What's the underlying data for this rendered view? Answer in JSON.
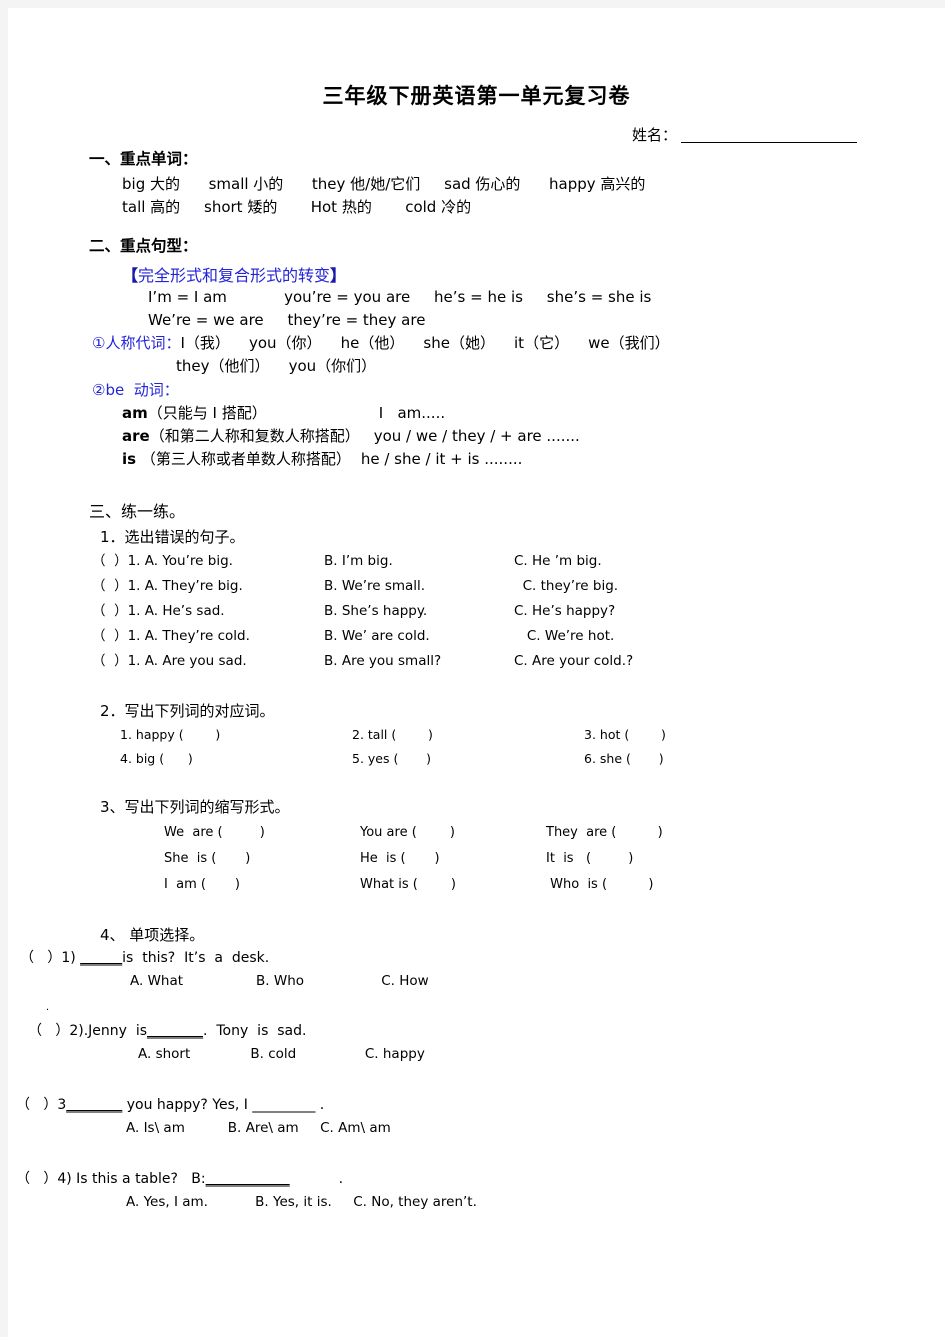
{
  "document": {
    "title": "三年级下册英语第一单元复习卷",
    "name_label": "姓名：",
    "name_blank": ""
  },
  "section_one": {
    "heading": "一、重点单词：",
    "rows": [
      "big 大的      small 小的      they 他/她/它们     sad 伤心的      happy 高兴的",
      "tall 高的     short 矮的       Hot 热的       cold 冷的"
    ]
  },
  "section_two": {
    "heading": "二、重点句型：",
    "bracket_open": "【",
    "bracket_title": "完全形式和复合形式的转变",
    "bracket_close": "】",
    "contraction_lines": [
      "I’m = I am            you’re = you are     he’s = he is     she’s = she is",
      "We’re = we are     they’re = they are"
    ],
    "pronoun_label": "①人称代词：",
    "pronoun_line1": "I（我）    you（你）    he（他）    she（她）    it（它）    we（我们）",
    "pronoun_line2": "they（他们）    you（你们）",
    "be_label": "②be  动词：",
    "be_rows": [
      {
        "verb": "am",
        "rule": "（只能与 I 搭配）",
        "example": "I   am....."
      },
      {
        "verb": "are",
        "rule": "（和第二人称和复数人称搭配）",
        "example": "you / we / they / + are ......."
      },
      {
        "verb": "is",
        "rule": " （第三人称或者单数人称搭配）",
        "example": "he / she / it + is ........"
      }
    ]
  },
  "section_three": {
    "heading": "三、练一练。",
    "ex1": {
      "heading": "1．选出错误的句子。",
      "rows": [
        {
          "stem": "（  ）1. A. You’re big.",
          "b": "B. I’m big.",
          "c": "C. He ’m big."
        },
        {
          "stem": "（  ）1. A. They’re big.",
          "b": "B. We’re small.",
          "c": "  C. they’re big."
        },
        {
          "stem": "（  ）1. A. He’s sad.",
          "b": "B. She’s happy.",
          "c": "C. He’s happy?"
        },
        {
          "stem": "（  ）1. A. They’re cold.",
          "b": "B. We’ are cold.",
          "c": "   C. We’re hot."
        },
        {
          "stem": "（  ）1. A. Are you sad.",
          "b": "B. Are you small?",
          "c": "C. Are your cold.?"
        }
      ]
    },
    "ex2": {
      "heading": "2．写出下列词的对应词。",
      "rows": [
        [
          "1. happy (        )",
          "2. tall (        )",
          "3. hot (        )"
        ],
        [
          "4. big (      )",
          "5. yes (       )",
          "6. she (       )"
        ]
      ]
    },
    "ex3": {
      "heading": "3、写出下列词的缩写形式。",
      "rows": [
        [
          "We  are (         )",
          "You are (        )",
          "They  are (          )"
        ],
        [
          "She  is (       )",
          "He  is (       )",
          "It  is   (         )"
        ],
        [
          "I  am (       )",
          "What is (        )",
          " Who  is (          )"
        ]
      ]
    },
    "ex4": {
      "heading": "4、 单项选择。",
      "stray_mark": ".",
      "questions": [
        {
          "stem_pre": "（   ）1) ",
          "stem_blank": "______",
          "stem_post": "is  this?  It’s  a  desk.",
          "options": "A. What                 B. Who                  C. How"
        },
        {
          "stem_pre": "（   ）2).Jenny  is",
          "stem_blank": "________",
          "stem_post": ".  Tony  is  sad.",
          "options": "A. short              B. cold                C. happy"
        },
        {
          "stem_pre": "（   ）3",
          "stem_blank": "________",
          "stem_post": " you happy? Yes, I _________ .",
          "options": "A. Is\\ am          B. Are\\ am     C. Am\\ am"
        },
        {
          "stem_pre": "（   ）4) Is this a table?   B:",
          "stem_blank": "____________",
          "stem_post": "           .",
          "options": "A. Yes, I am.           B. Yes, it is.     C. No, they aren’t."
        }
      ]
    }
  },
  "colors": {
    "accent_blue": "#2323d8",
    "bracket_navy": "#1a1aa8",
    "text": "#000000",
    "page_bg": "#ffffff",
    "canvas_bg": "#f4f4f4"
  }
}
